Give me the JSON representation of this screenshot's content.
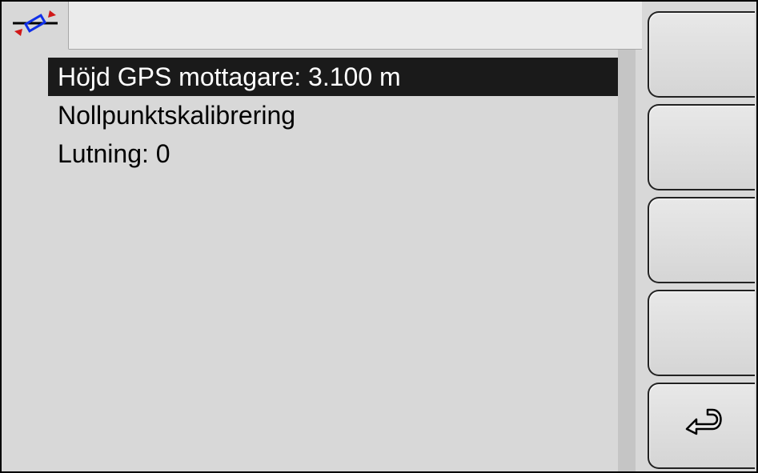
{
  "header": {
    "tab_icon": "calibration-icon"
  },
  "list": {
    "items": [
      {
        "label": "Höjd GPS mottagare: 3.100 m",
        "selected": true
      },
      {
        "label": "Nollpunktskalibrering",
        "selected": false
      },
      {
        "label": "Lutning: 0",
        "selected": false
      }
    ]
  },
  "side_buttons": [
    {
      "name": "side-button-1",
      "icon": null
    },
    {
      "name": "side-button-2",
      "icon": null
    },
    {
      "name": "side-button-3",
      "icon": null
    },
    {
      "name": "side-button-4",
      "icon": null
    },
    {
      "name": "side-button-back",
      "icon": "back-arrow-icon"
    }
  ]
}
